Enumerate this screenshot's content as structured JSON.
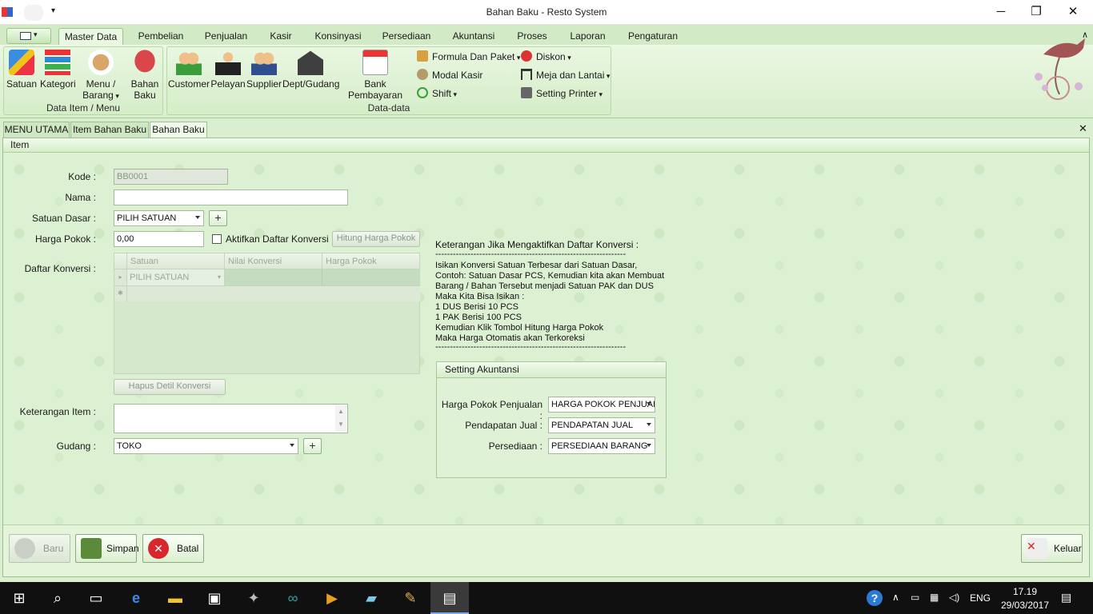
{
  "window": {
    "title": "Bahan Baku - Resto System"
  },
  "ribbon_tabs": [
    "Master Data",
    "Pembelian",
    "Penjualan",
    "Kasir",
    "Konsinyasi",
    "Persediaan",
    "Akuntansi",
    "Proses",
    "Laporan",
    "Pengaturan"
  ],
  "ribbon": {
    "group1": {
      "caption": "Data Item / Menu",
      "items": [
        {
          "label": "Satuan",
          "icon": "ruler-pencil-icon"
        },
        {
          "label": "Kategori",
          "icon": "stack-icon"
        },
        {
          "label": "Menu /",
          "label2": "Barang",
          "icon": "food-plate-icon"
        },
        {
          "label": "Bahan",
          "label2": "Baku",
          "icon": "meat-icon"
        }
      ]
    },
    "group2": {
      "caption": "Data-data",
      "items": [
        {
          "label": "Customer",
          "icon": "users-icon"
        },
        {
          "label": "Pelayan",
          "icon": "waiter-icon"
        },
        {
          "label": "Supplier",
          "icon": "supplier-icon"
        },
        {
          "label": "Dept/Gudang",
          "icon": "warehouse-icon"
        },
        {
          "label": "Bank Pembayaran",
          "icon": "calendar-money-icon"
        }
      ],
      "small": [
        {
          "label": "Formula Dan Paket",
          "icon": "box-icon"
        },
        {
          "label": "Modal Kasir",
          "icon": "money-bag-icon"
        },
        {
          "label": "Shift",
          "icon": "refresh-icon"
        },
        {
          "label": "Diskon",
          "icon": "discount-icon"
        },
        {
          "label": "Meja dan Lantai",
          "icon": "table-icon"
        },
        {
          "label": "Setting Printer",
          "icon": "printer-icon"
        }
      ]
    }
  },
  "doc_tabs": [
    "MENU UTAMA",
    "Item Bahan Baku",
    "Bahan Baku"
  ],
  "panel_header": "Item",
  "form": {
    "kode_label": "Kode :",
    "kode_value": "BB0001",
    "nama_label": "Nama :",
    "nama_value": "",
    "satuan_label": "Satuan Dasar :",
    "satuan_value": "PILIH SATUAN",
    "harga_label": "Harga Pokok :",
    "harga_value": "0,00",
    "aktifkan_label": "Aktifkan Daftar Konversi",
    "hitung_label": "Hitung Harga Pokok",
    "daftar_label": "Daftar Konversi :",
    "grid_headers": [
      "Satuan",
      "Nilai Konversi",
      "Harga Pokok"
    ],
    "grid_row_value": "PILIH SATUAN",
    "hapus_label": "Hapus Detil Konversi",
    "keterangan_label": "Keterangan Item :",
    "gudang_label": "Gudang :",
    "gudang_value": "TOKO",
    "plus": "+"
  },
  "info": {
    "title": "Keterangan Jika Mengaktifkan Daftar Konversi :",
    "divider": "-----------------------------------------------------------------",
    "lines": "Isikan Konversi Satuan Terbesar dari Satuan Dasar,\nContoh: Satuan Dasar PCS, Kemudian kita akan Membuat\nBarang / Bahan Tersebut menjadi Satuan PAK dan DUS\nMaka Kita Bisa Isikan :\n1 DUS Berisi 10 PCS\n1 PAK Berisi 100 PCS\nKemudian Klik Tombol Hitung Harga Pokok\nMaka Harga Otomatis akan Terkoreksi"
  },
  "akuntansi": {
    "caption": "Setting Akuntansi",
    "hpp_label": "Harga Pokok Penjualan :",
    "hpp_value": "HARGA POKOK PENJUAL",
    "pj_label": "Pendapatan Jual :",
    "pj_value": "PENDAPATAN JUAL",
    "ps_label": "Persediaan :",
    "ps_value": "PERSEDIAAN BARANG"
  },
  "buttons": {
    "baru": "Baru",
    "simpan": "Simpan",
    "batal": "Batal",
    "keluar": "Keluar"
  },
  "taskbar": {
    "lang": "ENG",
    "time": "17.19",
    "date": "29/03/2017"
  }
}
